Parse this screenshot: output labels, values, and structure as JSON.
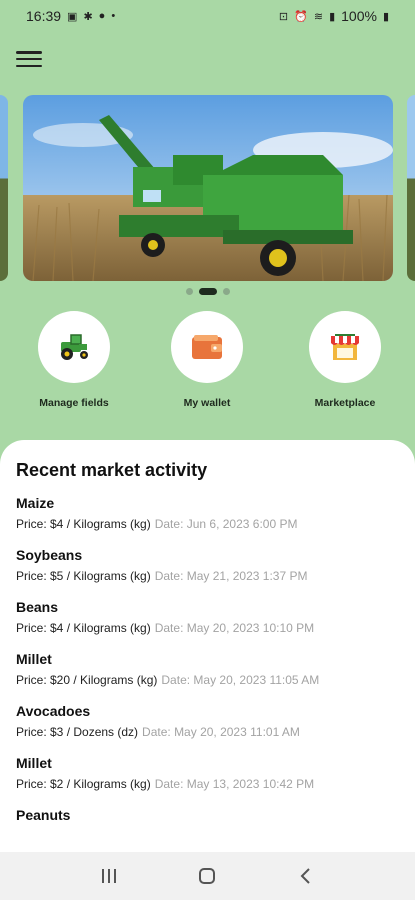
{
  "status_bar": {
    "time": "16:39",
    "battery": "100%",
    "dot": "•"
  },
  "carousel": {
    "slide_count": 3,
    "active_index": 1
  },
  "actions": [
    {
      "label": "Manage fields",
      "icon": "tractor-icon"
    },
    {
      "label": "My wallet",
      "icon": "wallet-icon"
    },
    {
      "label": "Marketplace",
      "icon": "market-stall-icon"
    }
  ],
  "recent": {
    "title": "Recent market activity",
    "items": [
      {
        "name": "Maize",
        "price": "Price: $4 / Kilograms (kg)",
        "date": "Date: Jun 6, 2023   6:00 PM"
      },
      {
        "name": "Soybeans",
        "price": "Price: $5 / Kilograms (kg)",
        "date": "Date: May 21, 2023   1:37 PM"
      },
      {
        "name": "Beans",
        "price": "Price: $4 / Kilograms (kg)",
        "date": "Date: May 20, 2023   10:10 PM"
      },
      {
        "name": "Millet",
        "price": "Price: $20 / Kilograms (kg)",
        "date": "Date: May 20, 2023   11:05 AM"
      },
      {
        "name": "Avocadoes",
        "price": "Price: $3 / Dozens (dz)",
        "date": "Date: May 20, 2023   11:01 AM"
      },
      {
        "name": "Millet",
        "price": "Price: $2 / Kilograms (kg)",
        "date": "Date: May 13, 2023   10:42 PM"
      },
      {
        "name": "Peanuts",
        "price": "",
        "date": ""
      }
    ]
  },
  "colors": {
    "background": "#a9d8a5",
    "sheet": "#ffffff",
    "date_text": "#a3a3a3"
  }
}
